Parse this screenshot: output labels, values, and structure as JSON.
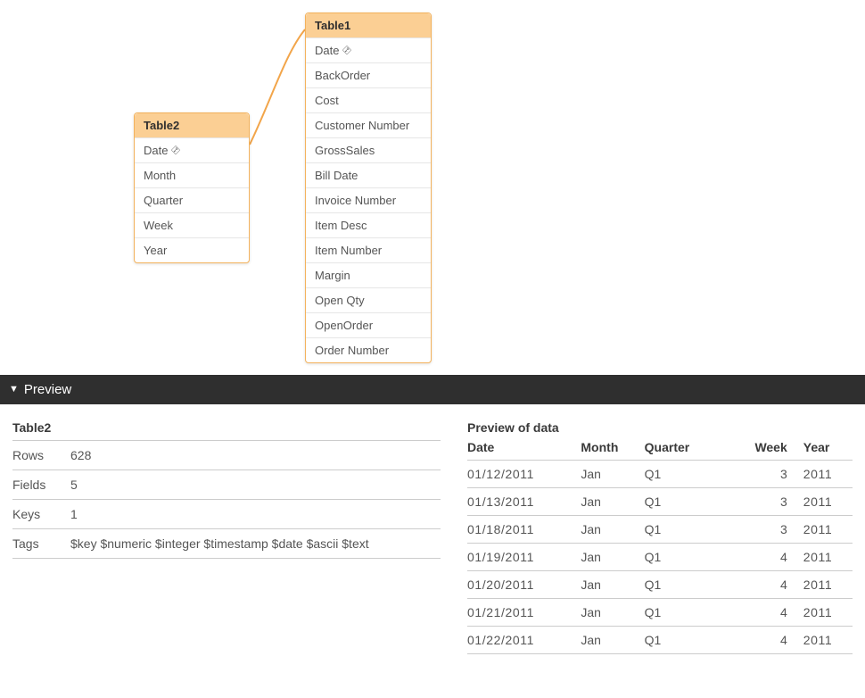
{
  "tables": {
    "table1": {
      "name": "Table1",
      "fields": [
        {
          "name": "Date",
          "isKey": true
        },
        {
          "name": "BackOrder",
          "isKey": false
        },
        {
          "name": "Cost",
          "isKey": false
        },
        {
          "name": "Customer Number",
          "isKey": false
        },
        {
          "name": "GrossSales",
          "isKey": false
        },
        {
          "name": "Bill Date",
          "isKey": false
        },
        {
          "name": "Invoice Number",
          "isKey": false
        },
        {
          "name": "Item Desc",
          "isKey": false
        },
        {
          "name": "Item Number",
          "isKey": false
        },
        {
          "name": "Margin",
          "isKey": false
        },
        {
          "name": "Open Qty",
          "isKey": false
        },
        {
          "name": "OpenOrder",
          "isKey": false
        },
        {
          "name": "Order Number",
          "isKey": false
        }
      ]
    },
    "table2": {
      "name": "Table2",
      "fields": [
        {
          "name": "Date",
          "isKey": true
        },
        {
          "name": "Month",
          "isKey": false
        },
        {
          "name": "Quarter",
          "isKey": false
        },
        {
          "name": "Week",
          "isKey": false
        },
        {
          "name": "Year",
          "isKey": false
        }
      ]
    }
  },
  "previewBar": {
    "label": "Preview"
  },
  "meta": {
    "title": "Table2",
    "rows": [
      {
        "label": "Rows",
        "value": "628"
      },
      {
        "label": "Fields",
        "value": "5"
      },
      {
        "label": "Keys",
        "value": "1"
      },
      {
        "label": "Tags",
        "value": "$key $numeric $integer $timestamp $date $ascii $text"
      }
    ]
  },
  "dataPreview": {
    "title": "Preview of data",
    "columns": [
      "Date",
      "Month",
      "Quarter",
      "Week",
      "Year"
    ],
    "rows": [
      {
        "date": "01/12/2011",
        "month": "Jan",
        "quarter": "Q1",
        "week": "3",
        "year": "2011"
      },
      {
        "date": "01/13/2011",
        "month": "Jan",
        "quarter": "Q1",
        "week": "3",
        "year": "2011"
      },
      {
        "date": "01/18/2011",
        "month": "Jan",
        "quarter": "Q1",
        "week": "3",
        "year": "2011"
      },
      {
        "date": "01/19/2011",
        "month": "Jan",
        "quarter": "Q1",
        "week": "4",
        "year": "2011"
      },
      {
        "date": "01/20/2011",
        "month": "Jan",
        "quarter": "Q1",
        "week": "4",
        "year": "2011"
      },
      {
        "date": "01/21/2011",
        "month": "Jan",
        "quarter": "Q1",
        "week": "4",
        "year": "2011"
      },
      {
        "date": "01/22/2011",
        "month": "Jan",
        "quarter": "Q1",
        "week": "4",
        "year": "2011"
      }
    ]
  }
}
